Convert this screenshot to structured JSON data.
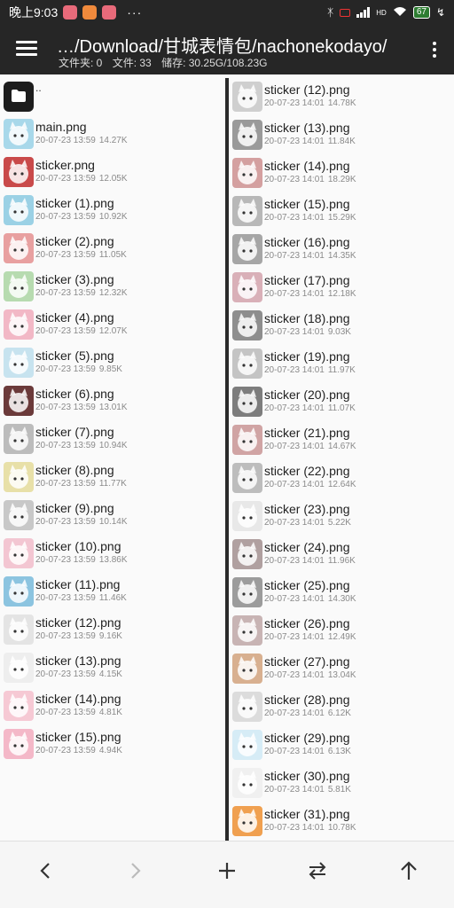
{
  "status_bar": {
    "time": "晚上9:03",
    "more": "···",
    "network": "HD",
    "battery": "67"
  },
  "header": {
    "path": "…/Download/甘城表情包/nachonekodayo/",
    "folders": "文件夹: 0",
    "files": "文件: 33",
    "storage": "储存: 30.25G/108.23G"
  },
  "colors": {
    "bar_bg": "#262626",
    "pane_bg": "#fafafa",
    "divider": "#2a2a2a"
  },
  "left_pane": {
    "updir": "..",
    "files": [
      {
        "name": "main.png",
        "date": "20-07-23 13:59",
        "size": "14.27K",
        "thumb": "#a8d8ea"
      },
      {
        "name": "sticker.png",
        "date": "20-07-23 13:59",
        "size": "12.05K",
        "thumb": "#c94a4a"
      },
      {
        "name": "sticker (1).png",
        "date": "20-07-23 13:59",
        "size": "10.92K",
        "thumb": "#9bd1e5"
      },
      {
        "name": "sticker (2).png",
        "date": "20-07-23 13:59",
        "size": "11.05K",
        "thumb": "#e8a0a0"
      },
      {
        "name": "sticker (3).png",
        "date": "20-07-23 13:59",
        "size": "12.32K",
        "thumb": "#b7dbb0"
      },
      {
        "name": "sticker (4).png",
        "date": "20-07-23 13:59",
        "size": "12.07K",
        "thumb": "#f2b8c6"
      },
      {
        "name": "sticker (5).png",
        "date": "20-07-23 13:59",
        "size": "9.85K",
        "thumb": "#c7e3ef"
      },
      {
        "name": "sticker (6).png",
        "date": "20-07-23 13:59",
        "size": "13.01K",
        "thumb": "#6b3a3a"
      },
      {
        "name": "sticker (7).png",
        "date": "20-07-23 13:59",
        "size": "10.94K",
        "thumb": "#bcbcbc"
      },
      {
        "name": "sticker (8).png",
        "date": "20-07-23 13:59",
        "size": "11.77K",
        "thumb": "#e8e0a8"
      },
      {
        "name": "sticker (9).png",
        "date": "20-07-23 13:59",
        "size": "10.14K",
        "thumb": "#c8c8c8"
      },
      {
        "name": "sticker (10).png",
        "date": "20-07-23 13:59",
        "size": "13.86K",
        "thumb": "#f3c6d2"
      },
      {
        "name": "sticker (11).png",
        "date": "20-07-23 13:59",
        "size": "11.46K",
        "thumb": "#8cc4e0"
      },
      {
        "name": "sticker (12).png",
        "date": "20-07-23 13:59",
        "size": "9.16K",
        "thumb": "#e4e4e4"
      },
      {
        "name": "sticker (13).png",
        "date": "20-07-23 13:59",
        "size": "4.15K",
        "thumb": "#eeeeee"
      },
      {
        "name": "sticker (14).png",
        "date": "20-07-23 13:59",
        "size": "4.81K",
        "thumb": "#f6c9d4"
      },
      {
        "name": "sticker (15).png",
        "date": "20-07-23 13:59",
        "size": "4.94K",
        "thumb": "#f4b8c8"
      }
    ]
  },
  "right_pane": {
    "files": [
      {
        "name": "sticker (12).png",
        "date": "20-07-23 14:01",
        "size": "14.78K",
        "thumb": "#cfcfcf"
      },
      {
        "name": "sticker (13).png",
        "date": "20-07-23 14:01",
        "size": "11.84K",
        "thumb": "#9a9a9a"
      },
      {
        "name": "sticker (14).png",
        "date": "20-07-23 14:01",
        "size": "18.29K",
        "thumb": "#d4a0a0"
      },
      {
        "name": "sticker (15).png",
        "date": "20-07-23 14:01",
        "size": "15.29K",
        "thumb": "#b8b8b8"
      },
      {
        "name": "sticker (16).png",
        "date": "20-07-23 14:01",
        "size": "14.35K",
        "thumb": "#a6a6a6"
      },
      {
        "name": "sticker (17).png",
        "date": "20-07-23 14:01",
        "size": "12.18K",
        "thumb": "#d9b0b8"
      },
      {
        "name": "sticker (18).png",
        "date": "20-07-23 14:01",
        "size": "9.03K",
        "thumb": "#8e8e8e"
      },
      {
        "name": "sticker (19).png",
        "date": "20-07-23 14:01",
        "size": "11.97K",
        "thumb": "#c4c4c4"
      },
      {
        "name": "sticker (20).png",
        "date": "20-07-23 14:01",
        "size": "11.07K",
        "thumb": "#7d7d7d"
      },
      {
        "name": "sticker (21).png",
        "date": "20-07-23 14:01",
        "size": "14.67K",
        "thumb": "#d0a4a4"
      },
      {
        "name": "sticker (22).png",
        "date": "20-07-23 14:01",
        "size": "12.64K",
        "thumb": "#bdbdbd"
      },
      {
        "name": "sticker (23).png",
        "date": "20-07-23 14:01",
        "size": "5.22K",
        "thumb": "#e8e8e8"
      },
      {
        "name": "sticker (24).png",
        "date": "20-07-23 14:01",
        "size": "11.96K",
        "thumb": "#b0a0a0"
      },
      {
        "name": "sticker (25).png",
        "date": "20-07-23 14:01",
        "size": "14.30K",
        "thumb": "#9c9c9c"
      },
      {
        "name": "sticker (26).png",
        "date": "20-07-23 14:01",
        "size": "12.49K",
        "thumb": "#c8b4b4"
      },
      {
        "name": "sticker (27).png",
        "date": "20-07-23 14:01",
        "size": "13.04K",
        "thumb": "#d8b090"
      },
      {
        "name": "sticker (28).png",
        "date": "20-07-23 14:01",
        "size": "6.12K",
        "thumb": "#dcdcdc"
      },
      {
        "name": "sticker (29).png",
        "date": "20-07-23 14:01",
        "size": "6.13K",
        "thumb": "#d6ecf6"
      },
      {
        "name": "sticker (30).png",
        "date": "20-07-23 14:01",
        "size": "5.81K",
        "thumb": "#f0f0f0"
      },
      {
        "name": "sticker (31).png",
        "date": "20-07-23 14:01",
        "size": "10.78K",
        "thumb": "#f0a050"
      }
    ]
  },
  "bottom_bar": {
    "buttons": [
      "chevron-left-icon",
      "chevron-right-icon",
      "plus-icon",
      "swap-icon",
      "arrow-up-icon"
    ]
  }
}
